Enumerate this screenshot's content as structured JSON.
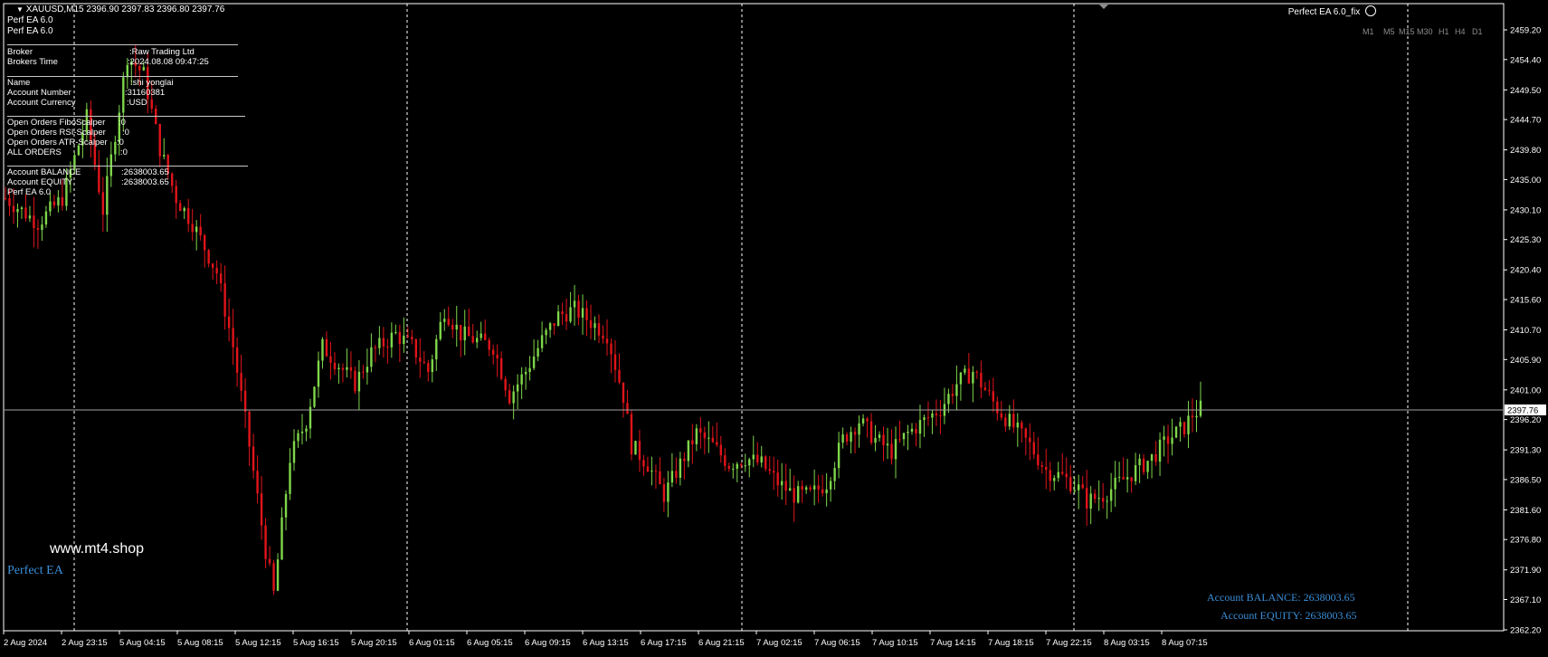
{
  "symbol_header": {
    "arrow": "▼",
    "text": "XAUUSD,M15  2396.90 2397.83 2396.80 2397.76"
  },
  "ea_lines": [
    "Perf EA 6.0",
    "Perf EA 6.0"
  ],
  "top_right_label": "Perfect EA 6.0_fix",
  "timeframes": [
    "M1",
    "M5",
    "M15",
    "M30",
    "H1",
    "H4",
    "D1"
  ],
  "info_panel": {
    "broker": {
      "label": "Broker",
      "value": ":Raw Trading Ltd"
    },
    "brokers_time": {
      "label": "Brokers Time",
      "value": ":2024.08.08 09:47:25"
    },
    "name": {
      "label": "Name",
      "value": ":shi yonglai"
    },
    "account_number": {
      "label": "Account Number",
      "value": ":31160381"
    },
    "account_currency": {
      "label": "Account Currency",
      "value": ":USD"
    },
    "open_fibo": {
      "label": "Open Orders FiboScalper",
      "value": ":0"
    },
    "open_rsi": {
      "label": "Open Orders RSI-Scalper",
      "value": ":0"
    },
    "open_atr": {
      "label": "Open Orders ATR-Scalper",
      "value": ":0"
    },
    "all_orders": {
      "label": "ALL ORDERS",
      "value": ":0"
    },
    "balance": {
      "label": "Account BALANCE",
      "value": ":2638003.65"
    },
    "equity": {
      "label": "Account EQUITY",
      "value": ":2638003.65"
    },
    "footer": "Perf EA 6.0"
  },
  "brand": {
    "site": "www.mt4.shop",
    "name": "Perfect EA"
  },
  "account_overlay": {
    "balance_label": "Account BALANCE:",
    "balance_value": "2638003.65",
    "equity_label": "Account EQUITY:",
    "equity_value": "2638003.65"
  },
  "colors": {
    "bull": "#7fd64a",
    "bear": "#e0141a",
    "grid": "#ffffff",
    "axis_text": "#ffffff",
    "price_line": "#a0a0a0"
  },
  "chart_data": {
    "type": "candlestick",
    "symbol": "XAUUSD",
    "timeframe": "M15",
    "last_price": "2397.76",
    "y_ticks": [
      "2459.20",
      "2454.40",
      "2449.50",
      "2444.70",
      "2439.80",
      "2435.00",
      "2430.10",
      "2425.30",
      "2420.40",
      "2415.60",
      "2410.70",
      "2405.90",
      "2401.00",
      "2396.20",
      "2391.30",
      "2386.50",
      "2381.60",
      "2376.80",
      "2371.90",
      "2367.10",
      "2362.20"
    ],
    "ylim": [
      2361.5,
      2461.5
    ],
    "x_ticks": [
      "2 Aug 2024",
      "2 Aug 23:15",
      "5 Aug 04:15",
      "5 Aug 08:15",
      "5 Aug 12:15",
      "5 Aug 16:15",
      "5 Aug 20:15",
      "6 Aug 01:15",
      "6 Aug 05:15",
      "6 Aug 09:15",
      "6 Aug 13:15",
      "6 Aug 17:15",
      "6 Aug 21:15",
      "7 Aug 02:15",
      "7 Aug 06:15",
      "7 Aug 10:15",
      "7 Aug 14:15",
      "7 Aug 18:15",
      "7 Aug 22:15",
      "8 Aug 03:15",
      "8 Aug 07:15"
    ],
    "day_separators": [
      "5 Aug",
      "6 Aug",
      "7 Aug",
      "8 Aug"
    ],
    "price_path": [
      [
        0,
        2432
      ],
      [
        8,
        2428
      ],
      [
        14,
        2432
      ],
      [
        20,
        2445
      ],
      [
        24,
        2430
      ],
      [
        30,
        2455
      ],
      [
        34,
        2452
      ],
      [
        38,
        2440
      ],
      [
        42,
        2432
      ],
      [
        46,
        2428
      ],
      [
        52,
        2420
      ],
      [
        56,
        2408
      ],
      [
        60,
        2392
      ],
      [
        64,
        2375
      ],
      [
        66,
        2368
      ],
      [
        70,
        2390
      ],
      [
        74,
        2396
      ],
      [
        78,
        2408
      ],
      [
        82,
        2405
      ],
      [
        86,
        2402
      ],
      [
        90,
        2407
      ],
      [
        96,
        2410
      ],
      [
        100,
        2408
      ],
      [
        104,
        2404
      ],
      [
        108,
        2414
      ],
      [
        112,
        2410
      ],
      [
        116,
        2409
      ],
      [
        120,
        2408
      ],
      [
        124,
        2400
      ],
      [
        128,
        2404
      ],
      [
        132,
        2409
      ],
      [
        136,
        2413
      ],
      [
        140,
        2414
      ],
      [
        144,
        2412
      ],
      [
        148,
        2410
      ],
      [
        152,
        2400
      ],
      [
        154,
        2392
      ],
      [
        158,
        2389
      ],
      [
        162,
        2384
      ],
      [
        166,
        2389
      ],
      [
        170,
        2394
      ],
      [
        174,
        2392
      ],
      [
        178,
        2389
      ],
      [
        182,
        2390
      ],
      [
        186,
        2389
      ],
      [
        190,
        2386
      ],
      [
        194,
        2384
      ],
      [
        198,
        2384
      ],
      [
        202,
        2386
      ],
      [
        206,
        2393
      ],
      [
        210,
        2396
      ],
      [
        214,
        2393
      ],
      [
        218,
        2391
      ],
      [
        222,
        2394
      ],
      [
        226,
        2396
      ],
      [
        230,
        2398
      ],
      [
        234,
        2402
      ],
      [
        238,
        2404
      ],
      [
        242,
        2400
      ],
      [
        244,
        2398
      ],
      [
        248,
        2395
      ],
      [
        252,
        2392
      ],
      [
        256,
        2388
      ],
      [
        260,
        2387
      ],
      [
        264,
        2385
      ],
      [
        266,
        2383
      ],
      [
        270,
        2384
      ],
      [
        274,
        2386
      ],
      [
        278,
        2388
      ],
      [
        282,
        2390
      ],
      [
        286,
        2393
      ],
      [
        290,
        2395
      ],
      [
        292,
        2397
      ],
      [
        294,
        2398
      ]
    ]
  }
}
